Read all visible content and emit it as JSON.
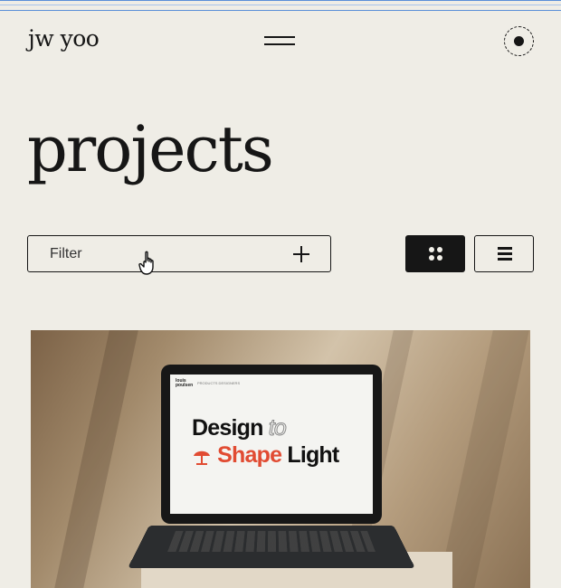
{
  "header": {
    "logo": "jw yoo",
    "menu_icon": "hamburger-menu-icon",
    "theme_toggle_icon": "dark-mode-toggle-icon"
  },
  "page": {
    "title": "projects"
  },
  "filter": {
    "label": "Filter",
    "add_icon": "plus-icon"
  },
  "view_toggle": {
    "grid_icon": "grid-view-icon",
    "list_icon": "list-view-icon",
    "active": "grid"
  },
  "project_card": {
    "image_title_line1": "Design",
    "image_title_line1_outline": "to",
    "image_title_line2_accent": "Shape",
    "image_title_line2": "Light",
    "mini_logo": "louis poulsen",
    "mini_nav": "PRODUCTS   DESIGNERS"
  },
  "colors": {
    "background": "#efede6",
    "ink": "#161616",
    "accent": "#e14b32"
  }
}
